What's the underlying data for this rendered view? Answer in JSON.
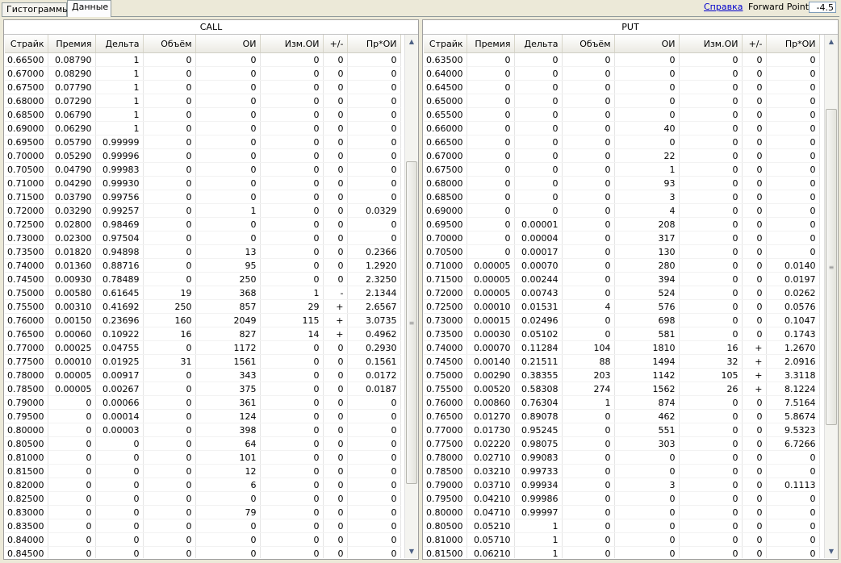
{
  "tabs": [
    "Гистограммы",
    "Данные"
  ],
  "help_link": "Справка",
  "forward_point": {
    "label": "Forward Point:",
    "value": "-4.5"
  },
  "columns": [
    "Страйк",
    "Премия",
    "Дельта",
    "Объём",
    "ОИ",
    "Изм.ОИ",
    "+/-",
    "Пр*ОИ"
  ],
  "call": {
    "title": "CALL",
    "rows": [
      [
        "0.66500",
        "0.08790",
        "1",
        "0",
        "0",
        "0",
        "0",
        "0"
      ],
      [
        "0.67000",
        "0.08290",
        "1",
        "0",
        "0",
        "0",
        "0",
        "0"
      ],
      [
        "0.67500",
        "0.07790",
        "1",
        "0",
        "0",
        "0",
        "0",
        "0"
      ],
      [
        "0.68000",
        "0.07290",
        "1",
        "0",
        "0",
        "0",
        "0",
        "0"
      ],
      [
        "0.68500",
        "0.06790",
        "1",
        "0",
        "0",
        "0",
        "0",
        "0"
      ],
      [
        "0.69000",
        "0.06290",
        "1",
        "0",
        "0",
        "0",
        "0",
        "0"
      ],
      [
        "0.69500",
        "0.05790",
        "0.99999",
        "0",
        "0",
        "0",
        "0",
        "0"
      ],
      [
        "0.70000",
        "0.05290",
        "0.99996",
        "0",
        "0",
        "0",
        "0",
        "0"
      ],
      [
        "0.70500",
        "0.04790",
        "0.99983",
        "0",
        "0",
        "0",
        "0",
        "0"
      ],
      [
        "0.71000",
        "0.04290",
        "0.99930",
        "0",
        "0",
        "0",
        "0",
        "0"
      ],
      [
        "0.71500",
        "0.03790",
        "0.99756",
        "0",
        "0",
        "0",
        "0",
        "0"
      ],
      [
        "0.72000",
        "0.03290",
        "0.99257",
        "0",
        "1",
        "0",
        "0",
        "0.0329"
      ],
      [
        "0.72500",
        "0.02800",
        "0.98469",
        "0",
        "0",
        "0",
        "0",
        "0"
      ],
      [
        "0.73000",
        "0.02300",
        "0.97504",
        "0",
        "0",
        "0",
        "0",
        "0"
      ],
      [
        "0.73500",
        "0.01820",
        "0.94898",
        "0",
        "13",
        "0",
        "0",
        "0.2366"
      ],
      [
        "0.74000",
        "0.01360",
        "0.88716",
        "0",
        "95",
        "0",
        "0",
        "1.2920"
      ],
      [
        "0.74500",
        "0.00930",
        "0.78489",
        "0",
        "250",
        "0",
        "0",
        "2.3250"
      ],
      [
        "0.75000",
        "0.00580",
        "0.61645",
        "19",
        "368",
        "1",
        "-",
        "2.1344"
      ],
      [
        "0.75500",
        "0.00310",
        "0.41692",
        "250",
        "857",
        "29",
        "+",
        "2.6567"
      ],
      [
        "0.76000",
        "0.00150",
        "0.23696",
        "160",
        "2049",
        "115",
        "+",
        "3.0735"
      ],
      [
        "0.76500",
        "0.00060",
        "0.10922",
        "16",
        "827",
        "14",
        "+",
        "0.4962"
      ],
      [
        "0.77000",
        "0.00025",
        "0.04755",
        "0",
        "1172",
        "0",
        "0",
        "0.2930"
      ],
      [
        "0.77500",
        "0.00010",
        "0.01925",
        "31",
        "1561",
        "0",
        "0",
        "0.1561"
      ],
      [
        "0.78000",
        "0.00005",
        "0.00917",
        "0",
        "343",
        "0",
        "0",
        "0.0172"
      ],
      [
        "0.78500",
        "0.00005",
        "0.00267",
        "0",
        "375",
        "0",
        "0",
        "0.0187"
      ],
      [
        "0.79000",
        "0",
        "0.00066",
        "0",
        "361",
        "0",
        "0",
        "0"
      ],
      [
        "0.79500",
        "0",
        "0.00014",
        "0",
        "124",
        "0",
        "0",
        "0"
      ],
      [
        "0.80000",
        "0",
        "0.00003",
        "0",
        "398",
        "0",
        "0",
        "0"
      ],
      [
        "0.80500",
        "0",
        "0",
        "0",
        "64",
        "0",
        "0",
        "0"
      ],
      [
        "0.81000",
        "0",
        "0",
        "0",
        "101",
        "0",
        "0",
        "0"
      ],
      [
        "0.81500",
        "0",
        "0",
        "0",
        "12",
        "0",
        "0",
        "0"
      ],
      [
        "0.82000",
        "0",
        "0",
        "0",
        "6",
        "0",
        "0",
        "0"
      ],
      [
        "0.82500",
        "0",
        "0",
        "0",
        "0",
        "0",
        "0",
        "0"
      ],
      [
        "0.83000",
        "0",
        "0",
        "0",
        "79",
        "0",
        "0",
        "0"
      ],
      [
        "0.83500",
        "0",
        "0",
        "0",
        "0",
        "0",
        "0",
        "0"
      ],
      [
        "0.84000",
        "0",
        "0",
        "0",
        "0",
        "0",
        "0",
        "0"
      ],
      [
        "0.84500",
        "0",
        "0",
        "0",
        "0",
        "0",
        "0",
        "0"
      ]
    ]
  },
  "put": {
    "title": "PUT",
    "rows": [
      [
        "0.63500",
        "0",
        "0",
        "0",
        "0",
        "0",
        "0",
        "0"
      ],
      [
        "0.64000",
        "0",
        "0",
        "0",
        "0",
        "0",
        "0",
        "0"
      ],
      [
        "0.64500",
        "0",
        "0",
        "0",
        "0",
        "0",
        "0",
        "0"
      ],
      [
        "0.65000",
        "0",
        "0",
        "0",
        "0",
        "0",
        "0",
        "0"
      ],
      [
        "0.65500",
        "0",
        "0",
        "0",
        "0",
        "0",
        "0",
        "0"
      ],
      [
        "0.66000",
        "0",
        "0",
        "0",
        "40",
        "0",
        "0",
        "0"
      ],
      [
        "0.66500",
        "0",
        "0",
        "0",
        "0",
        "0",
        "0",
        "0"
      ],
      [
        "0.67000",
        "0",
        "0",
        "0",
        "22",
        "0",
        "0",
        "0"
      ],
      [
        "0.67500",
        "0",
        "0",
        "0",
        "1",
        "0",
        "0",
        "0"
      ],
      [
        "0.68000",
        "0",
        "0",
        "0",
        "93",
        "0",
        "0",
        "0"
      ],
      [
        "0.68500",
        "0",
        "0",
        "0",
        "3",
        "0",
        "0",
        "0"
      ],
      [
        "0.69000",
        "0",
        "0",
        "0",
        "4",
        "0",
        "0",
        "0"
      ],
      [
        "0.69500",
        "0",
        "0.00001",
        "0",
        "208",
        "0",
        "0",
        "0"
      ],
      [
        "0.70000",
        "0",
        "0.00004",
        "0",
        "317",
        "0",
        "0",
        "0"
      ],
      [
        "0.70500",
        "0",
        "0.00017",
        "0",
        "130",
        "0",
        "0",
        "0"
      ],
      [
        "0.71000",
        "0.00005",
        "0.00070",
        "0",
        "280",
        "0",
        "0",
        "0.0140"
      ],
      [
        "0.71500",
        "0.00005",
        "0.00244",
        "0",
        "394",
        "0",
        "0",
        "0.0197"
      ],
      [
        "0.72000",
        "0.00005",
        "0.00743",
        "0",
        "524",
        "0",
        "0",
        "0.0262"
      ],
      [
        "0.72500",
        "0.00010",
        "0.01531",
        "4",
        "576",
        "0",
        "0",
        "0.0576"
      ],
      [
        "0.73000",
        "0.00015",
        "0.02496",
        "0",
        "698",
        "0",
        "0",
        "0.1047"
      ],
      [
        "0.73500",
        "0.00030",
        "0.05102",
        "0",
        "581",
        "0",
        "0",
        "0.1743"
      ],
      [
        "0.74000",
        "0.00070",
        "0.11284",
        "104",
        "1810",
        "16",
        "+",
        "1.2670"
      ],
      [
        "0.74500",
        "0.00140",
        "0.21511",
        "88",
        "1494",
        "32",
        "+",
        "2.0916"
      ],
      [
        "0.75000",
        "0.00290",
        "0.38355",
        "203",
        "1142",
        "105",
        "+",
        "3.3118"
      ],
      [
        "0.75500",
        "0.00520",
        "0.58308",
        "274",
        "1562",
        "26",
        "+",
        "8.1224"
      ],
      [
        "0.76000",
        "0.00860",
        "0.76304",
        "1",
        "874",
        "0",
        "0",
        "7.5164"
      ],
      [
        "0.76500",
        "0.01270",
        "0.89078",
        "0",
        "462",
        "0",
        "0",
        "5.8674"
      ],
      [
        "0.77000",
        "0.01730",
        "0.95245",
        "0",
        "551",
        "0",
        "0",
        "9.5323"
      ],
      [
        "0.77500",
        "0.02220",
        "0.98075",
        "0",
        "303",
        "0",
        "0",
        "6.7266"
      ],
      [
        "0.78000",
        "0.02710",
        "0.99083",
        "0",
        "0",
        "0",
        "0",
        "0"
      ],
      [
        "0.78500",
        "0.03210",
        "0.99733",
        "0",
        "0",
        "0",
        "0",
        "0"
      ],
      [
        "0.79000",
        "0.03710",
        "0.99934",
        "0",
        "3",
        "0",
        "0",
        "0.1113"
      ],
      [
        "0.79500",
        "0.04210",
        "0.99986",
        "0",
        "0",
        "0",
        "0",
        "0"
      ],
      [
        "0.80000",
        "0.04710",
        "0.99997",
        "0",
        "0",
        "0",
        "0",
        "0"
      ],
      [
        "0.80500",
        "0.05210",
        "1",
        "0",
        "0",
        "0",
        "0",
        "0"
      ],
      [
        "0.81000",
        "0.05710",
        "1",
        "0",
        "0",
        "0",
        "0",
        "0"
      ],
      [
        "0.81500",
        "0.06210",
        "1",
        "0",
        "0",
        "0",
        "0",
        "0"
      ]
    ]
  }
}
